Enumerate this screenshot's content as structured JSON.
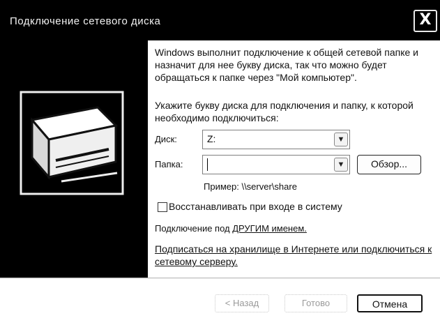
{
  "window": {
    "title": "Подключение сетевого диска",
    "close_glyph": "X"
  },
  "content": {
    "intro": "Windows выполнит подключение к общей сетевой папке и назначит для нее букву диска, так что можно будет обращаться к папке через \"Мой компьютер\".",
    "hint": "Укажите букву диска для подключения и папку, к которой необходимо подключиться:",
    "drive_label": "Диск:",
    "drive_value": "Z:",
    "folder_label": "Папка:",
    "folder_value": "",
    "browse_label": "Обзор...",
    "example": "Пример: \\\\server\\share",
    "reconnect_label": "Восстанавливать при входе в систему",
    "reconnect_checked": false,
    "other_user_prefix": "Подключение под ",
    "other_user_link": "ДРУГИМ именем.",
    "storage_link": "Подписаться на хранилище в Интернете или подключиться к сетевому серверу."
  },
  "footer": {
    "back_label": "< Назад",
    "finish_label": "Готово",
    "cancel_label": "Отмена"
  },
  "icons": {
    "drive": "network-drive-icon",
    "dropdown": "chevron-down-icon"
  }
}
